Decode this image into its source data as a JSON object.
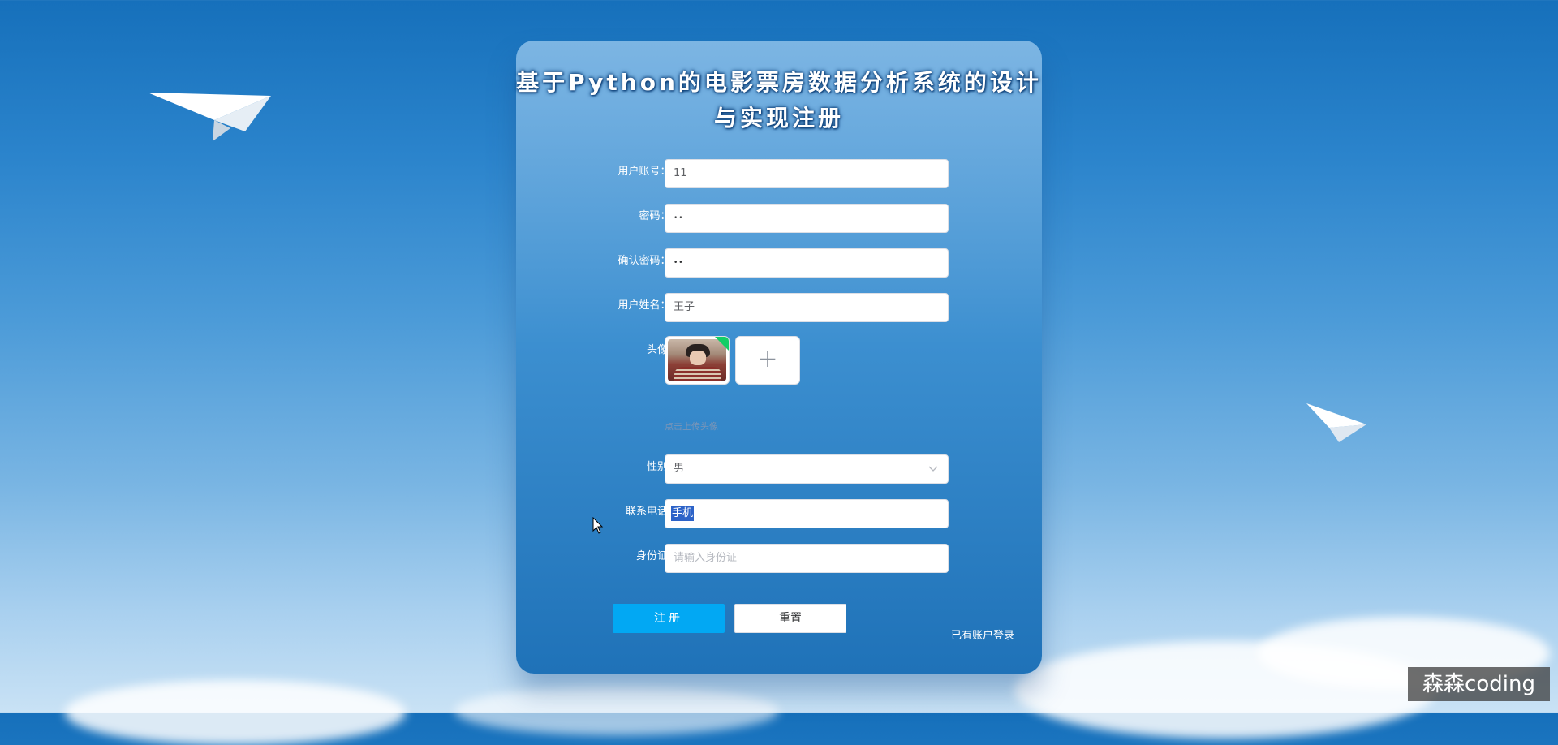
{
  "page": {
    "title": "基于Python的电影票房数据分析系统的设计与实现注册"
  },
  "form": {
    "fields": [
      {
        "label": "用户账号：",
        "required": true,
        "value": "11"
      },
      {
        "label": "密码：",
        "required": true,
        "value": "••"
      },
      {
        "label": "确认密码：",
        "required": true,
        "value": "••"
      },
      {
        "label": "用户姓名：",
        "required": true,
        "value": "王子"
      }
    ],
    "avatar": {
      "label": "头像：",
      "add_glyph": "+",
      "tip": "点击上传头像"
    },
    "gender": {
      "label": "性别：",
      "value": "男"
    },
    "phone": {
      "label": "联系电话：",
      "value": "手机"
    },
    "id_card": {
      "label": "身份证：",
      "placeholder": "请输入身份证"
    },
    "required_mark": "*"
  },
  "buttons": {
    "register": "注册",
    "reset": "重置"
  },
  "links": {
    "login": "已有账户登录"
  },
  "watermark": "森森coding",
  "colors": {
    "primary": "#02a8f3",
    "required": "#f56c6c",
    "upload_badge": "#13ce66"
  },
  "icons": {
    "select": "chevron-down-icon",
    "add": "plus-icon",
    "cursor": "mouse-pointer-icon",
    "planes": "paper-plane-icon"
  }
}
